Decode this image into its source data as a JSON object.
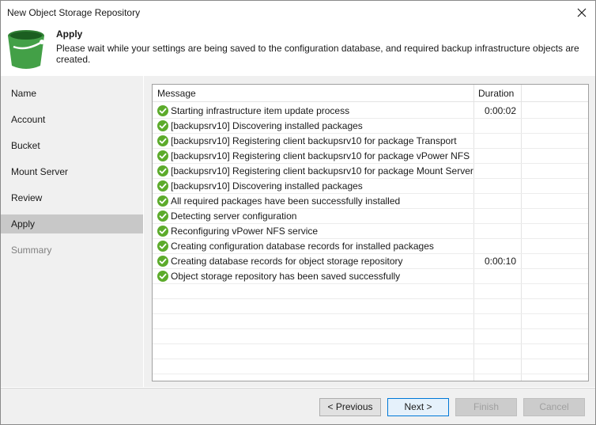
{
  "window": {
    "title": "New Object Storage Repository"
  },
  "header": {
    "title": "Apply",
    "description": "Please wait while your settings are being saved to the configuration database, and required backup infrastructure objects are created."
  },
  "sidebar": {
    "items": [
      {
        "label": "Name",
        "state": "normal"
      },
      {
        "label": "Account",
        "state": "normal"
      },
      {
        "label": "Bucket",
        "state": "normal"
      },
      {
        "label": "Mount Server",
        "state": "normal"
      },
      {
        "label": "Review",
        "state": "normal"
      },
      {
        "label": "Apply",
        "state": "active"
      },
      {
        "label": "Summary",
        "state": "disabled"
      }
    ]
  },
  "grid": {
    "columns": [
      "Message",
      "Duration"
    ],
    "rows": [
      {
        "message": "Starting infrastructure item update process",
        "duration": "0:00:02"
      },
      {
        "message": "[backupsrv10] Discovering installed packages",
        "duration": ""
      },
      {
        "message": "[backupsrv10] Registering client backupsrv10 for package Transport",
        "duration": ""
      },
      {
        "message": "[backupsrv10] Registering client backupsrv10 for package vPower NFS",
        "duration": ""
      },
      {
        "message": "[backupsrv10] Registering client backupsrv10 for package Mount Server",
        "duration": ""
      },
      {
        "message": "[backupsrv10] Discovering installed packages",
        "duration": ""
      },
      {
        "message": "All required packages have been successfully installed",
        "duration": ""
      },
      {
        "message": "Detecting server configuration",
        "duration": ""
      },
      {
        "message": "Reconfiguring vPower NFS service",
        "duration": ""
      },
      {
        "message": "Creating configuration database records for installed packages",
        "duration": ""
      },
      {
        "message": "Creating database records for object storage repository",
        "duration": "0:00:10"
      },
      {
        "message": "Object storage repository has been saved successfully",
        "duration": ""
      }
    ]
  },
  "footer": {
    "previous": "< Previous",
    "next": "Next >",
    "finish": "Finish",
    "cancel": "Cancel"
  },
  "icons": {
    "status": "check-circle-icon",
    "header": "bucket-icon",
    "close": "close-icon"
  },
  "colors": {
    "success": "#5cab2b",
    "bucket": "#43a047",
    "active_nav": "#c8c8c8"
  }
}
